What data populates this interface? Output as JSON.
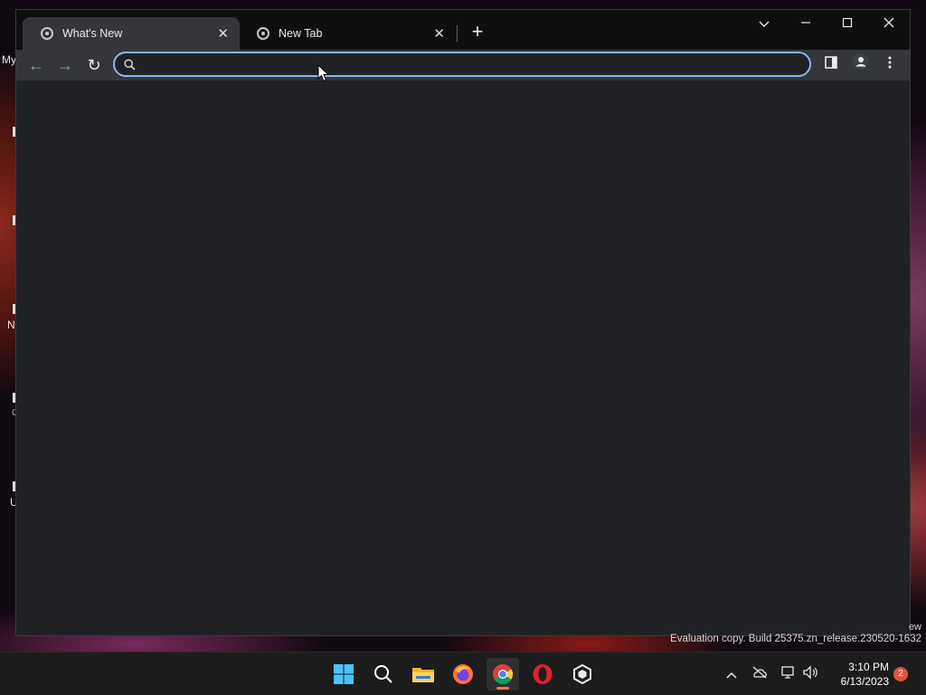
{
  "desktop": {
    "fragments": [
      "My",
      "N",
      "C",
      "U"
    ],
    "watermark_partial": "ew",
    "watermark": "Evaluation copy. Build 25375.zn_release.230520-1632"
  },
  "browser": {
    "tabs": [
      {
        "title": "What's New",
        "active": true
      },
      {
        "title": "New Tab",
        "active": false
      }
    ],
    "new_tab_label": "+",
    "window_controls": {
      "dropdown": "⌄",
      "minimize": "—",
      "maximize": "☐",
      "close": "✕"
    },
    "toolbar": {
      "back_icon": "←",
      "forward_icon": "→",
      "reload_icon": "↻",
      "omnibox": {
        "value": "",
        "placeholder": ""
      }
    },
    "accent_color": "#8ab4f8"
  },
  "taskbar": {
    "apps": [
      "start",
      "search",
      "file-explorer",
      "firefox",
      "chrome",
      "opera",
      "unity"
    ],
    "active_app": "chrome",
    "tray": {
      "time": "3:10 PM",
      "date": "6/13/2023",
      "notification_count": "2"
    }
  }
}
